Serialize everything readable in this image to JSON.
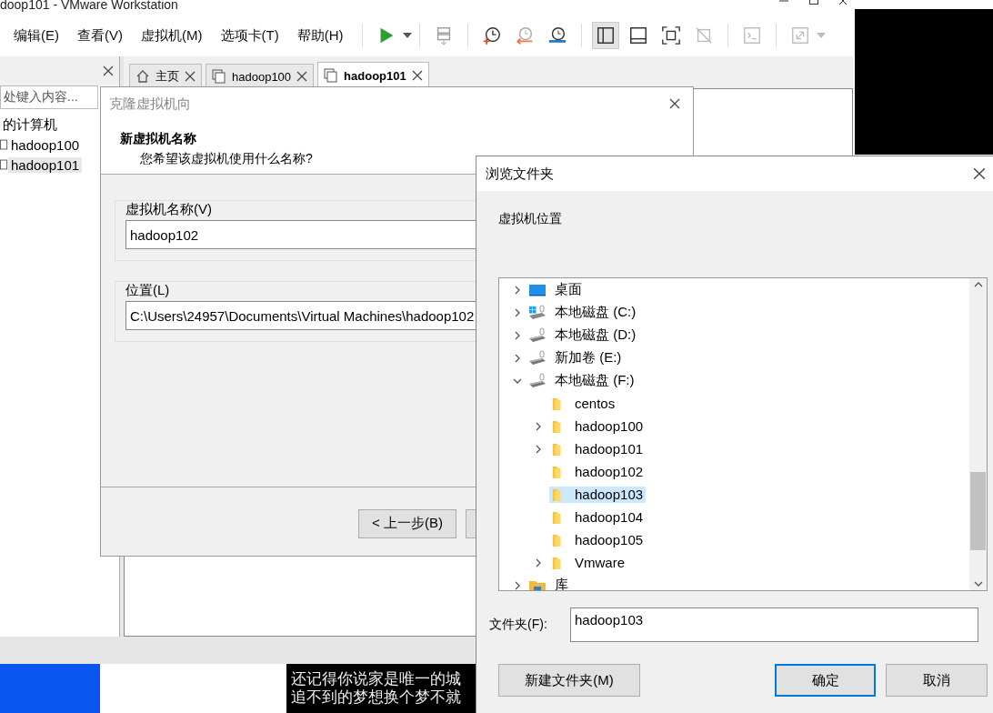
{
  "main_window": {
    "title": "doop101 - VMware Workstation",
    "menu": [
      "编辑(E)",
      "查看(V)",
      "虚拟机(M)",
      "选项卡(T)",
      "帮助(H)"
    ],
    "tabs": [
      {
        "label": "主页",
        "kind": "home",
        "selected": false
      },
      {
        "label": "hadoop100",
        "kind": "vm",
        "selected": false
      },
      {
        "label": "hadoop101",
        "kind": "vm",
        "selected": true
      }
    ],
    "library": {
      "search_placeholder": "处键入内容...",
      "tree": [
        {
          "label": "的计算机",
          "children": [
            {
              "label": "hadoop100",
              "selected": false
            },
            {
              "label": "hadoop101",
              "selected": true
            }
          ]
        }
      ]
    }
  },
  "clone_wizard": {
    "title": "克隆虚拟机向",
    "heading": "新虚拟机名称",
    "subheading": "您希望该虚拟机使用什么名称?",
    "name_label": "虚拟机名称(V)",
    "name_value": "hadoop102",
    "location_label": "位置(L)",
    "location_value": "C:\\Users\\24957\\Documents\\Virtual Machines\\hadoop102",
    "back_button": "< 上一步(B)"
  },
  "browse_dialog": {
    "title": "浏览文件夹",
    "description": "虚拟机位置",
    "tree": [
      {
        "children": [
          {
            "label": "桌面",
            "kind": "desktop",
            "expandable": true,
            "expanded": false,
            "selected": false
          },
          {
            "label": "本地磁盘 (C:)",
            "kind": "system-drive",
            "expandable": true,
            "expanded": false,
            "selected": false
          },
          {
            "label": "本地磁盘 (D:)",
            "kind": "drive",
            "expandable": true,
            "expanded": false,
            "selected": false
          },
          {
            "label": "新加卷 (E:)",
            "kind": "drive",
            "expandable": true,
            "expanded": false,
            "selected": false
          },
          {
            "label": "本地磁盘 (F:)",
            "kind": "drive",
            "expandable": true,
            "expanded": true,
            "selected": false,
            "children": [
              {
                "label": "centos",
                "kind": "folder",
                "expandable": false,
                "selected": false
              },
              {
                "label": "hadoop100",
                "kind": "folder",
                "expandable": true,
                "expanded": false,
                "selected": false
              },
              {
                "label": "hadoop101",
                "kind": "folder",
                "expandable": true,
                "expanded": false,
                "selected": false
              },
              {
                "label": "hadoop102",
                "kind": "folder",
                "expandable": false,
                "selected": false
              },
              {
                "label": "hadoop103",
                "kind": "folder",
                "expandable": false,
                "selected": true
              },
              {
                "label": "hadoop104",
                "kind": "folder",
                "expandable": false,
                "selected": false
              },
              {
                "label": "hadoop105",
                "kind": "folder",
                "expandable": false,
                "selected": false
              },
              {
                "label": "Vmware",
                "kind": "folder",
                "expandable": true,
                "expanded": false,
                "selected": false
              }
            ]
          }
        ]
      },
      {
        "label": "库",
        "kind": "library",
        "expandable": true,
        "expanded": false,
        "selected": false
      }
    ],
    "folder_label": "文件夹(F):",
    "folder_value": "hadoop103",
    "buttons": [
      {
        "label": "新建文件夹(M)",
        "kind": "new"
      },
      {
        "label": "确定",
        "kind": "ok"
      },
      {
        "label": "取消",
        "kind": "cancel"
      }
    ]
  },
  "lyrics": [
    "还记得你说家是唯一的城",
    "追不到的梦想换个梦不就"
  ]
}
